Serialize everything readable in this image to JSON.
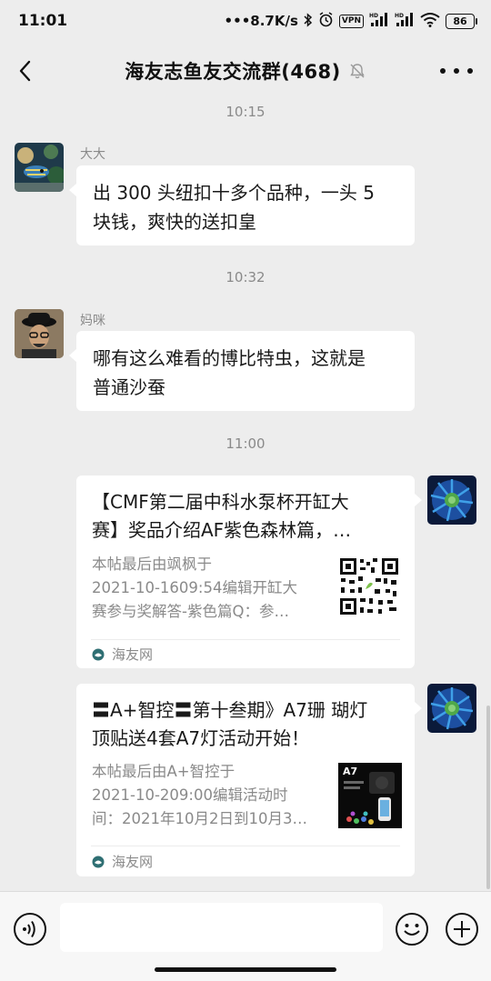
{
  "status": {
    "time": "11:01",
    "speed": "8.7K/s",
    "vpn": "VPN",
    "battery": "86",
    "signal_label": "HD"
  },
  "nav": {
    "title": "海友志鱼友交流群(468)"
  },
  "messages": [
    {
      "time": "10:15",
      "sender": "大大",
      "text_line1": "出 300 头纽扣十多个品种，一头 5",
      "text_line2": "块钱，爽快的送扣皇"
    },
    {
      "time": "10:32",
      "sender": "妈咪",
      "text_line1": "哪有这么难看的博比特虫，这就是",
      "text_line2": "普通沙蚕"
    }
  ],
  "time3": "11:00",
  "cards": [
    {
      "title_line1": "【CMF第二届中科水泵杯开缸大",
      "title_line2": "赛】奖品介绍AF紫色森林篇，…",
      "desc_line1": "本帖最后由飒枫于",
      "desc_line2": "2021-10-1609:54编辑开缸大",
      "desc_line3": "赛参与奖解答-紫色篇Q：参…",
      "source": "海友网"
    },
    {
      "title_line1": "〓A+智控〓第十叁期》A7珊 瑚灯",
      "title_line2": "顶贴送4套A7灯活动开始！",
      "desc_line1": "本帖最后由A+智控于",
      "desc_line2": "2021-10-209:00编辑活动时",
      "desc_line3": "间：2021年10月2日到10月3…",
      "source": "海友网",
      "thumb_label": "A7"
    }
  ],
  "colors": {
    "background": "#ededed",
    "bubble": "#ffffff",
    "meta_text": "#8a8a8a"
  }
}
